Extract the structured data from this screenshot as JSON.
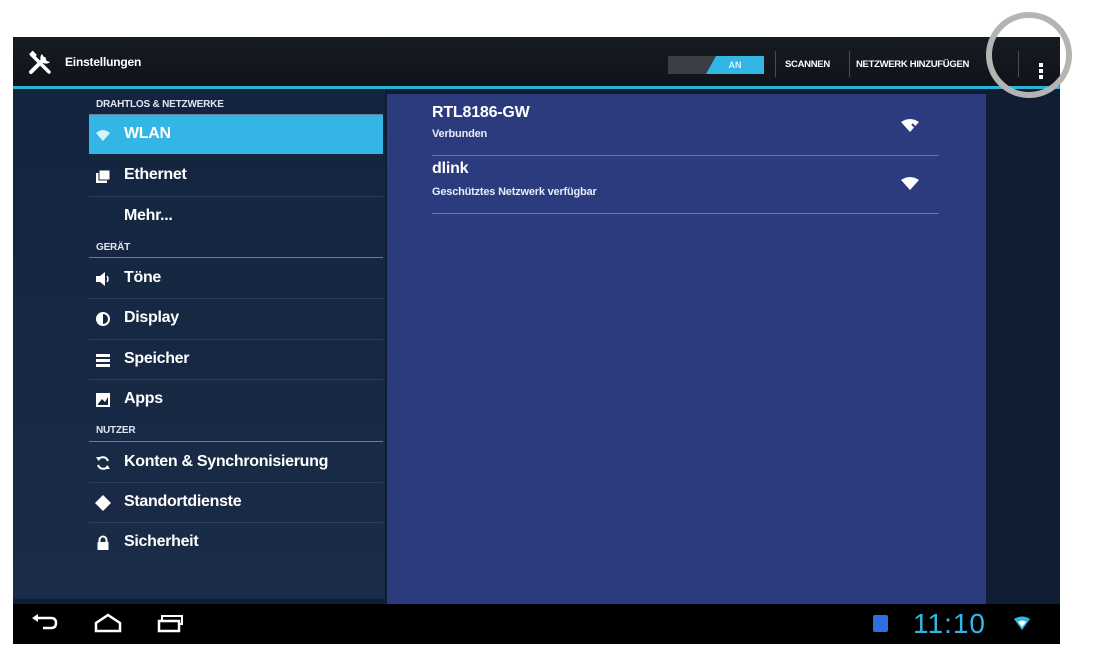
{
  "actionbar": {
    "title": "Einstellungen",
    "wifi_toggle_label": "AN",
    "scan_label": "SCANNEN",
    "add_network_label": "NETZWERK HINZUFÜGEN"
  },
  "sections": {
    "wireless": "DRAHTLOS & NETZWERKE",
    "device": "GERÄT",
    "user": "NUTZER"
  },
  "menu": {
    "wlan": "WLAN",
    "ethernet": "Ethernet",
    "more": "Mehr...",
    "sound": "Töne",
    "display": "Display",
    "storage": "Speicher",
    "apps": "Apps",
    "accounts": "Konten & Synchronisierung",
    "location": "Standortdienste",
    "security": "Sicherheit"
  },
  "networks": [
    {
      "name": "RTL8186-GW",
      "status": "Verbunden",
      "icon": "wifi-locked-icon"
    },
    {
      "name": "dlink",
      "status": "Geschütztes Netzwerk verfügbar",
      "icon": "wifi-icon"
    }
  ],
  "statusbar": {
    "time": "11:10"
  },
  "colors": {
    "accent": "#33b5e5",
    "content_bg": "#2b3b7e",
    "list_bg": "#13243f"
  }
}
